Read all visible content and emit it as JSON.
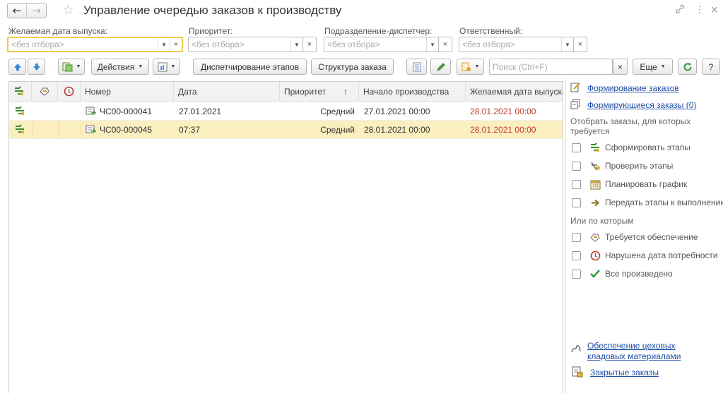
{
  "header": {
    "title": "Управление очередью заказов к производству",
    "back_glyph": "←",
    "forward_glyph": "→",
    "favorite_glyph": "☆",
    "link_glyph": "🔗",
    "menu_glyph": "⋮",
    "close_glyph": "×"
  },
  "filters": [
    {
      "label": "Желаемая дата выпуска:",
      "placeholder": "<без отбора>"
    },
    {
      "label": "Приоритет:",
      "placeholder": "<без отбора>"
    },
    {
      "label": "Подразделение-диспетчер:",
      "placeholder": "<без отбора>"
    },
    {
      "label": "Ответственный:",
      "placeholder": "<без отбора>"
    }
  ],
  "toolbar": {
    "actions_label": "Действия",
    "dispatch_label": "Диспетчирование этапов",
    "structure_label": "Структура заказа",
    "search_placeholder": "Поиск (Ctrl+F)",
    "more_label": "Еще",
    "help_label": "?",
    "clear_glyph": "×",
    "dropdown_glyph": "▼"
  },
  "table": {
    "columns": [
      "Номер",
      "Дата",
      "Приоритет",
      "Начало производства",
      "Желаемая дата выпуска"
    ],
    "sort_glyph": "↑",
    "rows": [
      {
        "number": "ЧС00-000041",
        "date": "27.01.2021",
        "priority": "Средний",
        "start": "27.01.2021 00:00",
        "desired": "28.01.2021 00:00",
        "selected": false
      },
      {
        "number": "ЧС00-000045",
        "date": "07:37",
        "priority": "Средний",
        "start": "28.01.2021 00:00",
        "desired": "28.01.2021 00:00",
        "selected": true
      }
    ]
  },
  "panel": {
    "link_form": "Формирование заказов",
    "link_forming": "Формирующиеся заказы (0)",
    "select_caption": "Отобрать заказы, для которых требуется",
    "checks_required": [
      {
        "label": "Сформировать этапы",
        "icon": "stages-icon"
      },
      {
        "label": "Проверить этапы",
        "icon": "check-stages-icon"
      },
      {
        "label": "Планировать график",
        "icon": "calendar-icon"
      },
      {
        "label": "Передать этапы к выполнению",
        "icon": "arrow-right-icon"
      }
    ],
    "or_caption": "Или по которым",
    "checks_or": [
      {
        "label": "Требуется обеспечение",
        "icon": "supply-icon"
      },
      {
        "label": "Нарушена дата потребности",
        "icon": "date-violated-icon"
      },
      {
        "label": "Все произведено",
        "icon": "checkmark-icon"
      }
    ],
    "link_supply_line1": "Обеспечение цеховых",
    "link_supply_line2": "кладовых материалами",
    "link_closed": "Закрытые заказы"
  },
  "colors": {
    "accent_focus": "#f2c94c",
    "selected_row": "#fbefbf",
    "link": "#1f4fa5",
    "overdue_date": "#c0392b",
    "green_refresh": "#2e9b3a"
  }
}
